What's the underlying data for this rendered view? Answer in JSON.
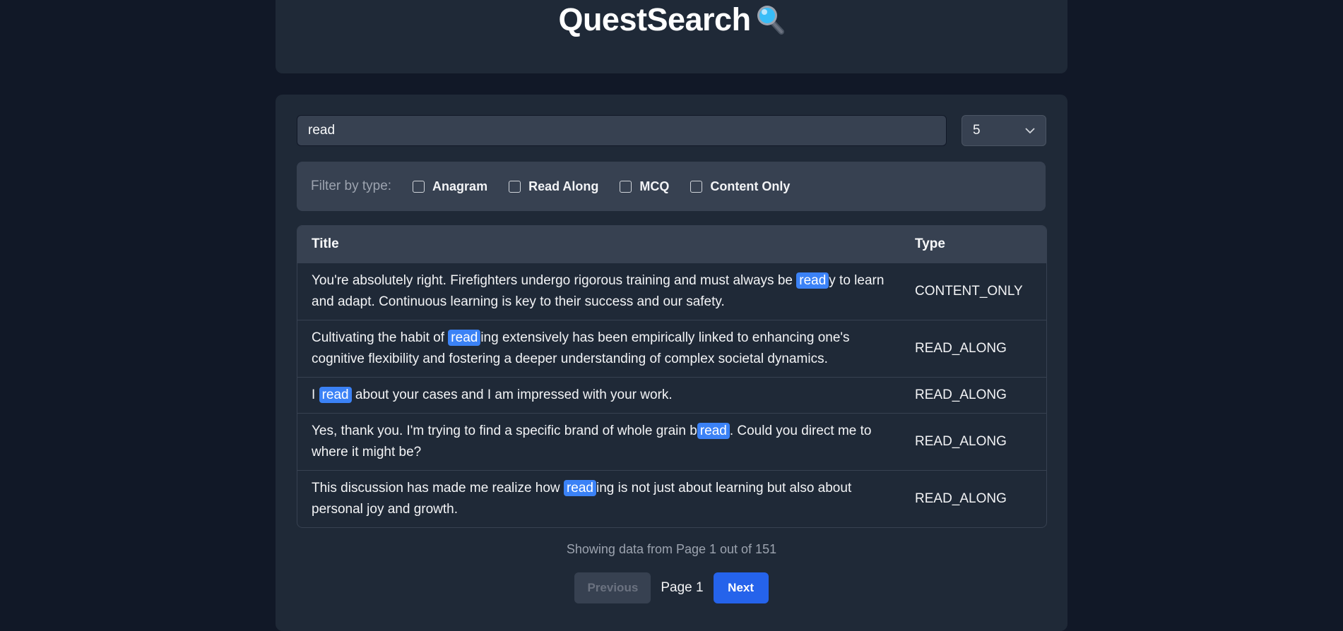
{
  "header": {
    "title": "QuestSearch",
    "icon": "magnifying-glass-icon"
  },
  "search": {
    "value": "read",
    "placeholder": ""
  },
  "per_page": {
    "selected": "5"
  },
  "filters": {
    "label": "Filter by type:",
    "options": [
      {
        "label": "Anagram",
        "checked": false
      },
      {
        "label": "Read Along",
        "checked": false
      },
      {
        "label": "MCQ",
        "checked": false
      },
      {
        "label": "Content Only",
        "checked": false
      }
    ]
  },
  "table": {
    "headers": {
      "title": "Title",
      "type": "Type"
    },
    "rows": [
      {
        "before": "You're absolutely right. Firefighters undergo rigorous training and must always be ",
        "match": "read",
        "after": "y to learn and adapt. Continuous learning is key to their success and our safety.",
        "type": "CONTENT_ONLY"
      },
      {
        "before": "Cultivating the habit of ",
        "match": "read",
        "after": "ing extensively has been empirically linked to enhancing one's cognitive flexibility and fostering a deeper understanding of complex societal dynamics.",
        "type": "READ_ALONG"
      },
      {
        "before": "I ",
        "match": "read",
        "after": " about your cases and I am impressed with your work.",
        "type": "READ_ALONG"
      },
      {
        "before": "Yes, thank you. I'm trying to find a specific brand of whole grain b",
        "match": "read",
        "after": ". Could you direct me to where it might be?",
        "type": "READ_ALONG"
      },
      {
        "before": "This discussion has made me realize how ",
        "match": "read",
        "after": "ing is not just about learning but also about personal joy and growth.",
        "type": "READ_ALONG"
      }
    ]
  },
  "pagination": {
    "status": "Showing data from Page 1 out of 151",
    "previous_label": "Previous",
    "page_label": "Page 1",
    "next_label": "Next"
  },
  "colors": {
    "background": "#111827",
    "card": "#1f2937",
    "surface": "#374151",
    "highlight": "#3b82f6",
    "primary_button": "#2563eb"
  }
}
